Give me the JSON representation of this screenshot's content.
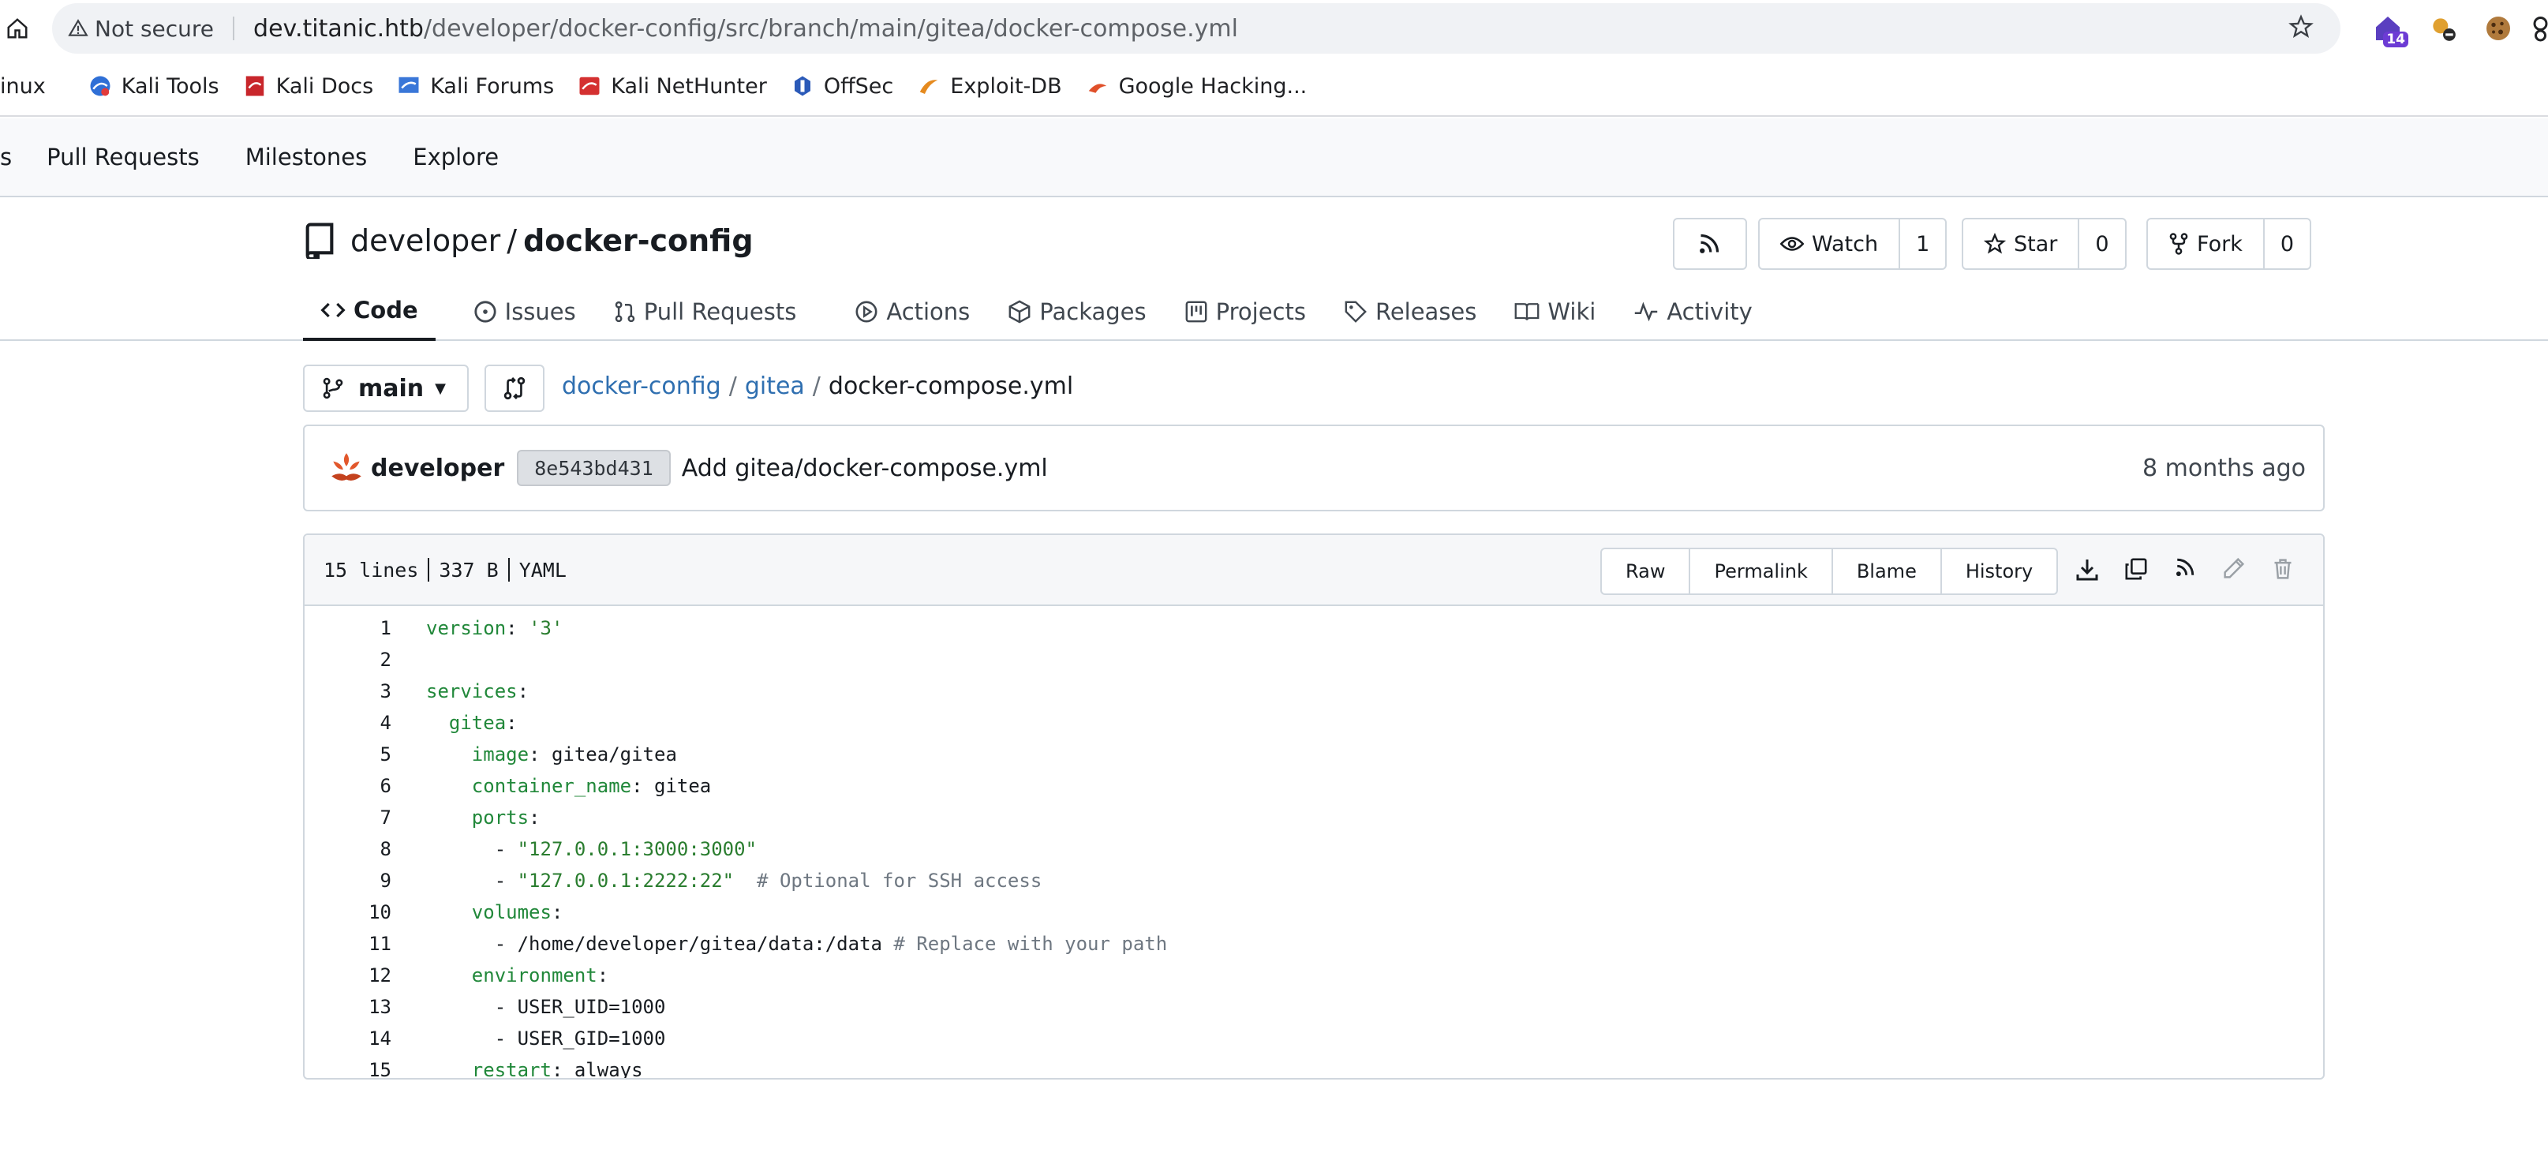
{
  "browser": {
    "not_secure_label": "Not secure",
    "url_host": "dev.titanic.htb",
    "url_path": "/developer/docker-config/src/branch/main/gitea/docker-compose.yml",
    "extension_badge": "14",
    "bookmarks": [
      {
        "label": "inux",
        "icon": "none"
      },
      {
        "label": "Kali Tools",
        "icon": "kali-tools-icon"
      },
      {
        "label": "Kali Docs",
        "icon": "kali-docs-icon"
      },
      {
        "label": "Kali Forums",
        "icon": "kali-forums-icon"
      },
      {
        "label": "Kali NetHunter",
        "icon": "kali-nethunter-icon"
      },
      {
        "label": "OffSec",
        "icon": "offsec-icon"
      },
      {
        "label": "Exploit-DB",
        "icon": "exploit-db-icon"
      },
      {
        "label": "Google Hacking...",
        "icon": "google-hacking-icon"
      }
    ]
  },
  "gitea_nav": {
    "items": [
      "s",
      "Pull Requests",
      "Milestones",
      "Explore"
    ]
  },
  "repo": {
    "owner": "developer",
    "separator": "/",
    "name": "docker-config",
    "watch_label": "Watch",
    "watch_count": "1",
    "star_label": "Star",
    "star_count": "0",
    "fork_label": "Fork",
    "fork_count": "0",
    "tabs": [
      {
        "label": "Code",
        "icon": "code-icon",
        "active": true
      },
      {
        "label": "Issues",
        "icon": "issue-icon"
      },
      {
        "label": "Pull Requests",
        "icon": "pull-request-icon"
      },
      {
        "label": "Actions",
        "icon": "play-icon"
      },
      {
        "label": "Packages",
        "icon": "package-icon"
      },
      {
        "label": "Projects",
        "icon": "project-icon"
      },
      {
        "label": "Releases",
        "icon": "tag-icon"
      },
      {
        "label": "Wiki",
        "icon": "book-icon"
      },
      {
        "label": "Activity",
        "icon": "pulse-icon"
      }
    ]
  },
  "branch": {
    "name": "main",
    "breadcrumb": [
      {
        "label": "docker-config",
        "link": true
      },
      {
        "label": "gitea",
        "link": true
      },
      {
        "label": "docker-compose.yml",
        "link": false
      }
    ],
    "separator": "/"
  },
  "commit": {
    "author": "developer",
    "sha": "8e543bd431",
    "message": "Add gitea/docker-compose.yml",
    "time": "8 months ago"
  },
  "file": {
    "lines_info": "15 lines",
    "size_info": "337 B",
    "lang_info": "YAML",
    "buttons": [
      "Raw",
      "Permalink",
      "Blame",
      "History"
    ],
    "code": [
      {
        "n": "1",
        "parts": [
          [
            "k",
            "version"
          ],
          [
            "p",
            ": "
          ],
          [
            "s",
            "'3'"
          ]
        ]
      },
      {
        "n": "2",
        "parts": []
      },
      {
        "n": "3",
        "parts": [
          [
            "k",
            "services"
          ],
          [
            "p",
            ":"
          ]
        ]
      },
      {
        "n": "4",
        "parts": [
          [
            "p",
            "  "
          ],
          [
            "k",
            "gitea"
          ],
          [
            "p",
            ":"
          ]
        ]
      },
      {
        "n": "5",
        "parts": [
          [
            "p",
            "    "
          ],
          [
            "k",
            "image"
          ],
          [
            "p",
            ": gitea/gitea"
          ]
        ]
      },
      {
        "n": "6",
        "parts": [
          [
            "p",
            "    "
          ],
          [
            "k",
            "container_name"
          ],
          [
            "p",
            ": gitea"
          ]
        ]
      },
      {
        "n": "7",
        "parts": [
          [
            "p",
            "    "
          ],
          [
            "k",
            "ports"
          ],
          [
            "p",
            ":"
          ]
        ]
      },
      {
        "n": "8",
        "parts": [
          [
            "p",
            "      - "
          ],
          [
            "s",
            "\"127.0.0.1:3000:3000\""
          ]
        ]
      },
      {
        "n": "9",
        "parts": [
          [
            "p",
            "      - "
          ],
          [
            "s",
            "\"127.0.0.1:2222:22\""
          ],
          [
            "p",
            "  "
          ],
          [
            "c",
            "# Optional for SSH access"
          ]
        ]
      },
      {
        "n": "10",
        "parts": [
          [
            "p",
            "    "
          ],
          [
            "k",
            "volumes"
          ],
          [
            "p",
            ":"
          ]
        ]
      },
      {
        "n": "11",
        "parts": [
          [
            "p",
            "      - /home/developer/gitea/data:/data "
          ],
          [
            "c",
            "# Replace with your path"
          ]
        ]
      },
      {
        "n": "12",
        "parts": [
          [
            "p",
            "    "
          ],
          [
            "k",
            "environment"
          ],
          [
            "p",
            ":"
          ]
        ]
      },
      {
        "n": "13",
        "parts": [
          [
            "p",
            "      - USER_UID=1000"
          ]
        ]
      },
      {
        "n": "14",
        "parts": [
          [
            "p",
            "      - USER_GID=1000"
          ]
        ]
      },
      {
        "n": "15",
        "parts": [
          [
            "p",
            "    "
          ],
          [
            "k",
            "restart"
          ],
          [
            "p",
            ": always"
          ]
        ]
      }
    ]
  },
  "colors": {
    "link": "#2f6fb0",
    "yaml_key": "#21883a",
    "yaml_string": "#2a7d2f",
    "yaml_comment": "#6e7781",
    "border": "#d0d7de"
  }
}
